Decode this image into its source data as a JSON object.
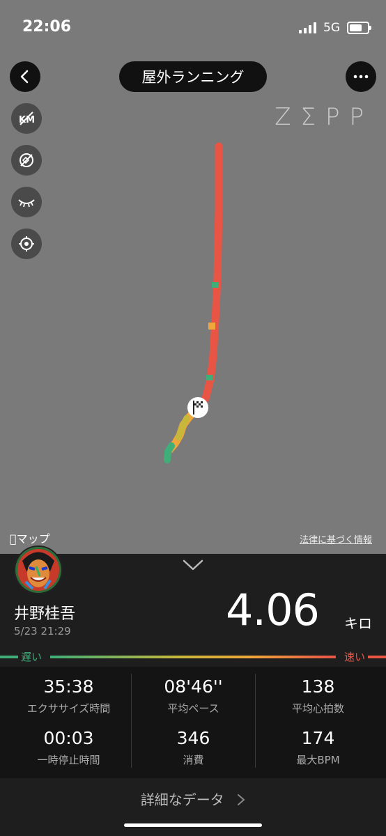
{
  "status": {
    "time": "22:06",
    "network": "5G"
  },
  "header": {
    "title": "屋外ランニング",
    "brand": "ZΣPP"
  },
  "tools": [
    {
      "name": "km-toggle-icon"
    },
    {
      "name": "layer-off-icon"
    },
    {
      "name": "eye-closed-icon"
    },
    {
      "name": "locate-icon"
    }
  ],
  "map": {
    "provider_label": "マップ",
    "legal_link": "法律に基づく情報"
  },
  "summary": {
    "user_name": "井野桂吾",
    "datetime": "5/23 21:29",
    "distance": "4.06",
    "distance_unit": "キロ"
  },
  "speed_scale": {
    "slow": "遅い",
    "fast": "速い",
    "colors": [
      "#3fae79",
      "#c7b83b",
      "#f0a63a",
      "#e85545"
    ]
  },
  "stats": [
    {
      "value": "35:38",
      "label": "エクササイズ時間"
    },
    {
      "value": "08'46''",
      "label": "平均ペース"
    },
    {
      "value": "138",
      "label": "平均心拍数"
    },
    {
      "value": "00:03",
      "label": "一時停止時間"
    },
    {
      "value": "346",
      "label": "消費"
    },
    {
      "value": "174",
      "label": "最大BPM"
    }
  ],
  "detail_label": "詳細なデータ"
}
